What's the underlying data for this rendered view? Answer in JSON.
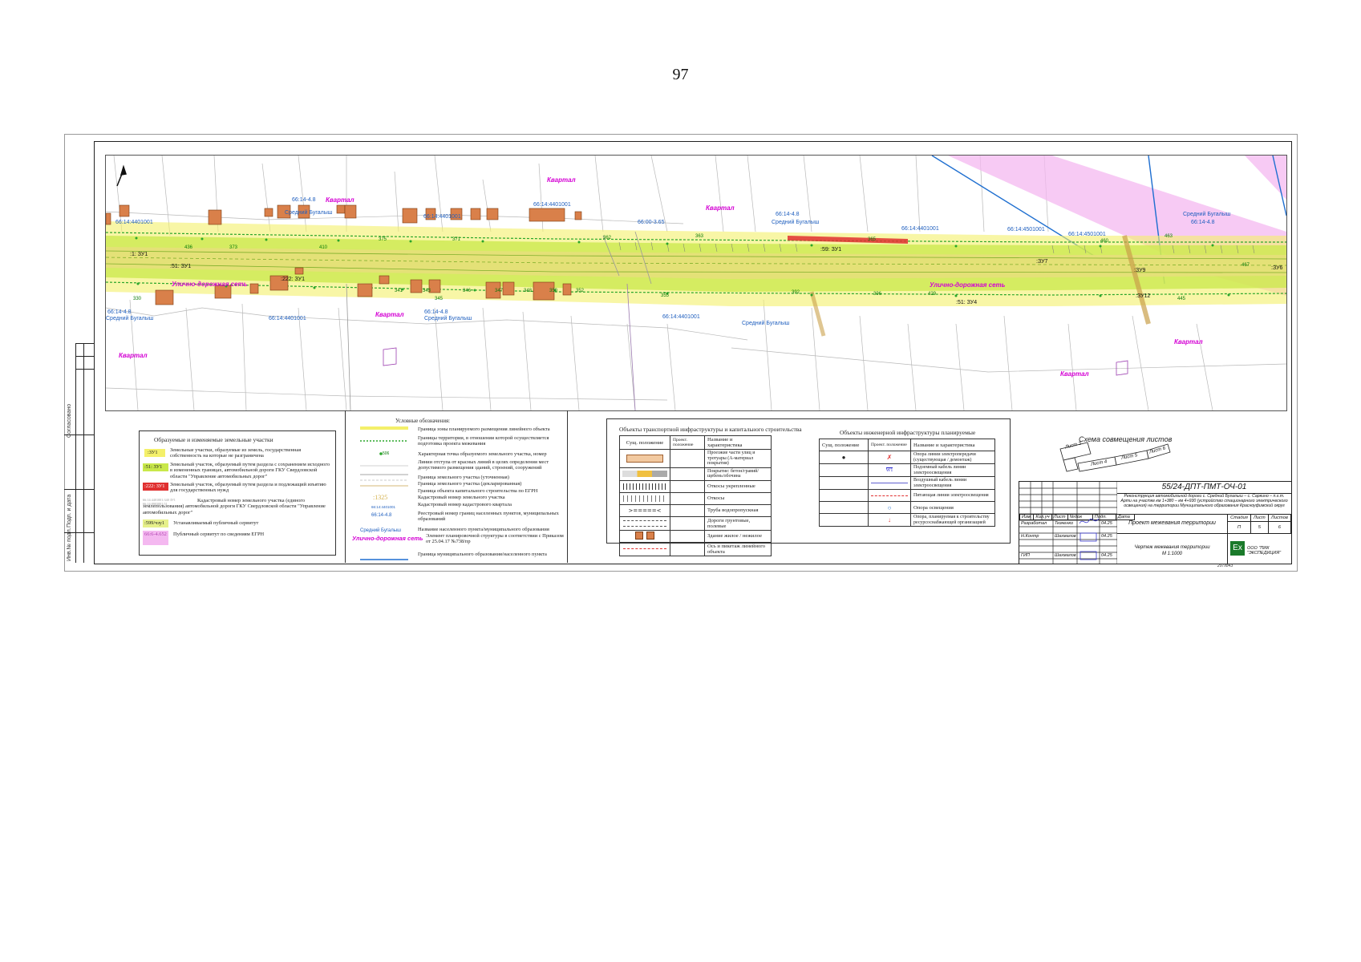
{
  "page_number": "97",
  "map": {
    "cadastral_labels": [
      "66:14:4401001",
      "66:14:4401001",
      "66:14:4401001",
      "66:14:4401001",
      "66:14:4401001",
      "66:14:4501001",
      "66:14:4501001",
      "66:14:4401001"
    ],
    "settlement_labels": [
      "66:14-4.8",
      "66:14-4.8",
      "66:14-4.8",
      "66:14-4.8",
      "66:14-4.8",
      "66:00-3.65"
    ],
    "settlement_names": [
      "Средний Бугалыш",
      "Средний Бугалыш",
      "Средний Бугалыш",
      "Средний Бугалыш",
      "Средний Бугалыш",
      "Средний Бугалыш"
    ],
    "kvartal": "Квартал",
    "street_network": "Улично-дорожная сеть",
    "zu_labels": [
      ":51: ЗУ1",
      ":1: ЗУ1",
      ":51: ЗУ4",
      ":59: ЗУ1",
      ":ЗУ7",
      ":ЗУ6",
      ":ЗУ9",
      ":ЗУ12",
      ":222: ЗУ1"
    ],
    "point_numbers": [
      "328",
      "330",
      "333",
      "335",
      "337",
      "340",
      "341",
      "343",
      "345",
      "346",
      "347",
      "348",
      "350",
      "352",
      "355",
      "357",
      "362",
      "363",
      "365",
      "366",
      "371",
      "373",
      "375",
      "381",
      "384",
      "386",
      "392",
      "396",
      "399",
      "410",
      "425",
      "429",
      "436",
      "438",
      "440",
      "445",
      "450",
      "459",
      "460",
      "462",
      "463",
      "466",
      "467"
    ]
  },
  "left_border": {
    "labels": [
      "Согласовано",
      "Подп. и дата",
      "Инв.№ подл."
    ]
  },
  "legend_zu": {
    "title": "Образуемые и изменяемые земельные участки",
    "rows": [
      {
        "swatch_text": ":ЗУ1",
        "text": "Земельные участки, образуемые из земель, государственная собственность на которые не разграничена"
      },
      {
        "swatch_text": ":51: ЗУ1",
        "text": "Земельный участок, образуемый путем раздела с сохранением исходного в измененных границах, автомобильной дороги ГКУ Свердловской области \"Управление автомобильных дорог\""
      },
      {
        "swatch_text": ":222: ЗУ1",
        "text": "Земельный участок, образуемый путем раздела и подлежащий изъятию для государственных нужд"
      },
      {
        "swatch_text": "66:14:4401001:340 ЗУ1 66:14:0903001:51",
        "text": "Кадастровый номер земельного участка (единого землепользования) автомобильной дороги ГКУ Свердловской области \"Управление автомобильных дорог\""
      },
      {
        "swatch_text": ":599/чзу1",
        "text": "Устанавливаемый публичный сервитут"
      },
      {
        "swatch_text": "66:6-4.652",
        "text": "Публичный сервитут по сведениям ЕГРН"
      }
    ]
  },
  "legend_symbols": {
    "title": "Условные обозначения:",
    "rows": [
      "Граница зоны планируемого размещения линейного объекта",
      "Границы территории, в отношении которой осуществляется подготовка проекта межевания",
      "Характерная точка образуемого земельного участка, номер",
      "Линии отступа от красных линий в целях определения мест допустимого размещения зданий, строений, сооружений",
      "Граница земельного участка (уточненная)",
      "Граница земельного участка (декларированная)",
      "Граница объекта капитального строительства по ЕГРН",
      "Кадастровый номер земельного участка",
      "Кадастровый номер кадастрового квартала",
      "Реестровый номер границ населенных пунктов, муниципальных образований",
      "Название населенного пункта/муниципального образования",
      "Элемент планировочной структуры в соответствии с Приказом от 25.04.17 №738/пр",
      "Граница муниципального образования/населенного пункта"
    ],
    "samples": {
      "point": "506",
      "zu": ":1325",
      "kk": "66:14:4401001",
      "reg": "66:14-4.8",
      "np": "Средний Бугалыш",
      "ep": "Улично-дорожная сеть"
    }
  },
  "legend_transport": {
    "title": "Объекты транспортной инфраструктуры и капитального строительства",
    "headers": [
      "Сущ. положение",
      "Проект. положение",
      "Название и характеристика"
    ],
    "rows": [
      "Проезжие части улиц и тротуары (А-материал покрытия)",
      "Покрытие: бетон/гравий/щебень/обочина",
      "Откосы укрепленные",
      "Откосы",
      "Труба водопропускная",
      "Дороги грунтовые, полевые",
      "Здание жилое / нежилое",
      "Ось и пикетаж линейного объекта"
    ]
  },
  "legend_engineering": {
    "title": "Объекты инженерной инфраструктуры планируемые",
    "headers": [
      "Сущ. положение",
      "Проект. положение",
      "Название и характеристика"
    ],
    "rows": [
      "Опора линии электропередачи (существующая / демонтаж)",
      "Подземный кабель линии электроосвещения",
      "Воздушный кабель линии электроосвещения",
      "Питающая линии электроосвещения",
      "Опора освещения",
      "Опора, планируемая к строительству ресурсоснабжающей организацией"
    ],
    "w1": "W1"
  },
  "sheet_scheme": {
    "title": "Схема совмещения листов",
    "sheets": [
      "Лист 3",
      "Лист 4",
      "Лист 5",
      "Лист 6"
    ]
  },
  "title_block": {
    "code": "55/24-ДПТ-ПМТ-ОЧ-01",
    "description": "Реконструкция автомобильной дороги с. Средний Бугалыш – с. Саркино – п.г.т. Арти на участке км 1+380 – км 4+930 (устройство стационарного электрического освещения) на территории Муниципального образования Красноуфимский округ",
    "header_cells": [
      "Изм.",
      "Кол.уч",
      "Лист",
      "№док",
      "Подп.",
      "Дата"
    ],
    "rows": [
      {
        "role": "Разработал",
        "name": "Ткаченко",
        "date": "04.25"
      },
      {
        "role": "Н.Контр",
        "name": "Шахмалов",
        "date": "04.25"
      },
      {
        "role": "ГИП",
        "name": "Шахмалов",
        "date": "04.25"
      }
    ],
    "project_title": "Проект межевания территории",
    "stage_headers": [
      "Стадия",
      "Лист",
      "Листов"
    ],
    "stage_values": [
      "П",
      "5",
      "6"
    ],
    "drawing_title": "Чертеж межевания территории",
    "scale": "М 1:1000",
    "company": "ООО \"ПИК \"ЭКСПЕДИЦИЯ\"",
    "logo_text": "Ex",
    "format": "297х843"
  },
  "colors": {
    "road_yellow": "#f4f06a",
    "zone_green": "#c9e84a",
    "servitude_pink": "#f4b8f0",
    "red_zone": "#e03030",
    "building": "#d9804a",
    "boundary_blue": "#1f6fd0"
  }
}
